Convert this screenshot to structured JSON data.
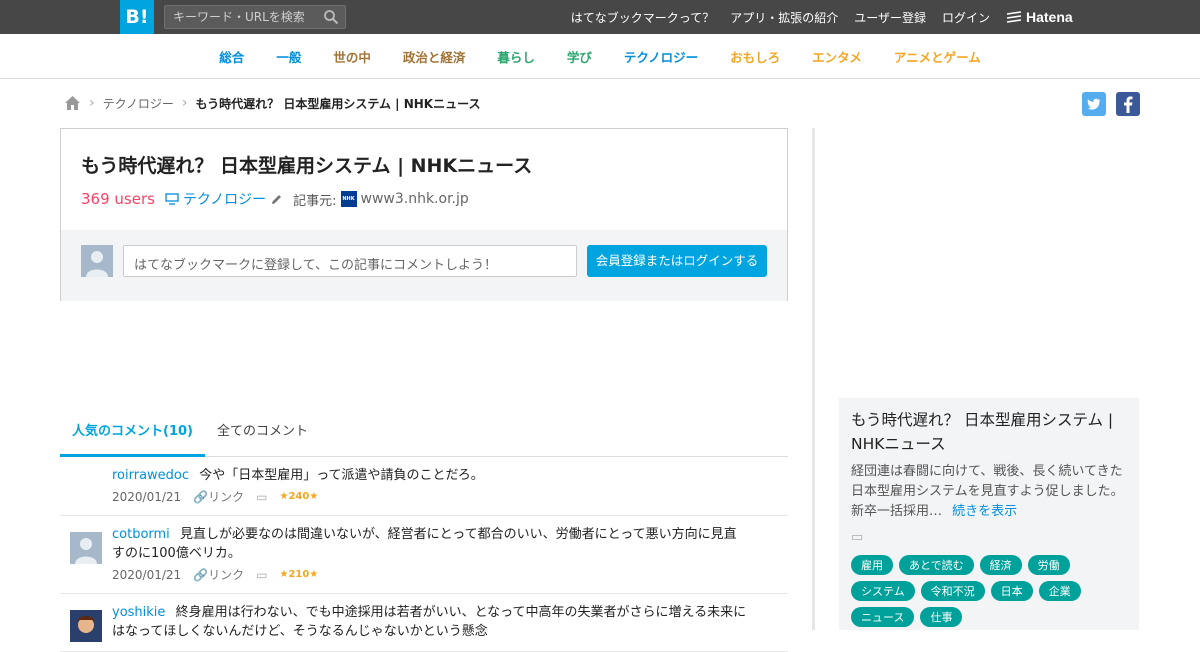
{
  "header": {
    "logo": "B!",
    "search_placeholder": "キーワード・URLを検索",
    "links": [
      "はてなブックマークって？",
      "アプリ・拡張の紹介",
      "ユーザー登録",
      "ログイン"
    ],
    "brand": "Hatena"
  },
  "nav": {
    "items": [
      {
        "label": "総合",
        "color": "#008fde"
      },
      {
        "label": "一般",
        "color": "#008fde"
      },
      {
        "label": "世の中",
        "color": "#a17336"
      },
      {
        "label": "政治と経済",
        "color": "#a17336"
      },
      {
        "label": "暮らし",
        "color": "#2ba66f"
      },
      {
        "label": "学び",
        "color": "#2ba66f"
      },
      {
        "label": "テクノロジー",
        "color": "#008fde"
      },
      {
        "label": "おもしろ",
        "color": "#f5a623"
      },
      {
        "label": "エンタメ",
        "color": "#f5a623"
      },
      {
        "label": "アニメとゲーム",
        "color": "#f5a623"
      }
    ]
  },
  "breadcrumb": {
    "category": "テクノロジー",
    "current": "もう時代遅れ？ 日本型雇用システム | NHKニュース"
  },
  "entry": {
    "title": "もう時代遅れ？ 日本型雇用システム | NHKニュース",
    "users": "369 users",
    "category": "テクノロジー",
    "source_label": "記事元:",
    "source_domain": "www3.nhk.or.jp",
    "favicon_text": "NHK",
    "comment_placeholder": "はてなブックマークに登録して、この記事にコメントしよう！",
    "login_button": "会員登録またはログインする"
  },
  "tabs": {
    "popular": "人気のコメント(10)",
    "all": "全てのコメント"
  },
  "comments": [
    {
      "user": "roirrawedoc",
      "text": "今や「日本型雇用」って派遣や請負のことだろ。",
      "date": "2020/01/21",
      "link": "リンク",
      "stars": "240",
      "avatar": "none"
    },
    {
      "user": "cotbormi",
      "text": "見直しが必要なのは間違いないが、経営者にとって都合のいい、労働者にとって悪い方向に見直すのに100億ベリカ。",
      "date": "2020/01/21",
      "link": "リンク",
      "stars": "210",
      "avatar": "default"
    },
    {
      "user": "yoshikie",
      "text": "終身雇用は行わない、でも中途採用は若者がいい、となって中高年の失業者がさらに増える未来にはなってほしくないんだけど、そうなるんじゃないかという懸念",
      "date": "",
      "link": "",
      "stars": "",
      "avatar": "pic"
    }
  ],
  "sidebar": {
    "title": "もう時代遅れ？ 日本型雇用システム | NHKニュース",
    "summary": "経団連は春闘に向けて、戦後、長く続いてきた日本型雇用システムを見直すよう促しました。新卒一括採用…",
    "more": "続きを表示",
    "tags": [
      "雇用",
      "あとで読む",
      "経済",
      "労働",
      "システム",
      "令和不況",
      "日本",
      "企業",
      "ニュース",
      "仕事"
    ]
  }
}
